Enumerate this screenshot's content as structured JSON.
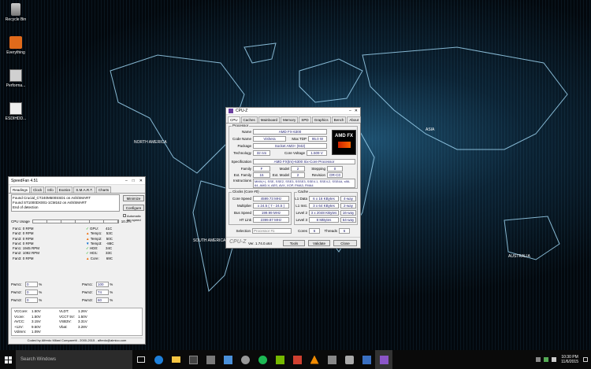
{
  "desktop": {
    "icons": [
      "Recycle Bin",
      "Everything",
      "Performa...",
      "ESDIHDD..."
    ]
  },
  "speedfan": {
    "title": "SpeedFan 4.51",
    "tabs": [
      "Readings",
      "Clock",
      "Info",
      "Exotics",
      "S.M.A.R.T.",
      "Charts"
    ],
    "log": [
      "Found Crucial_CT240M500SSD1 on Ash/SMART",
      "Found ST1000DX001-1CM162 on Ash/SMART",
      "End of detection"
    ],
    "minimize": "Minimize",
    "configure": "Configure",
    "autofan": "Automatic fan speed",
    "cpu_usage_label": "CPU Usage",
    "cpu_usage_value": "10.3%",
    "fans": [
      "Fan1: 0 RPM",
      "Fan2: 0 RPM",
      "Fan3: 0 RPM",
      "Fan4: 0 RPM",
      "Fan1: 1945 RPM",
      "Fan2: 1092 RPM",
      "Fan3: 0 RPM"
    ],
    "temps": [
      {
        "label": "GPU:",
        "value": "41C"
      },
      {
        "label": "Temp1:",
        "value": "53C"
      },
      {
        "label": "Temp2:",
        "value": "50C"
      },
      {
        "label": "Temp3:",
        "value": "-88C"
      },
      {
        "label": "HD0:",
        "value": "34C"
      },
      {
        "label": "HD1:",
        "value": "33C"
      },
      {
        "label": "Core:",
        "value": "69C"
      }
    ],
    "pwm_left": [
      {
        "label": "Pwm1:",
        "value": "0",
        "unit": "%"
      },
      {
        "label": "Pwm2:",
        "value": "0",
        "unit": "%"
      },
      {
        "label": "Pwm3:",
        "value": "0",
        "unit": "%"
      }
    ],
    "pwm_right": [
      {
        "label": "Pwm1:",
        "value": "100",
        "unit": "%"
      },
      {
        "label": "Pwm2:",
        "value": "74",
        "unit": "%"
      },
      {
        "label": "Pwm3:",
        "value": "60",
        "unit": "%"
      }
    ],
    "volts_left": [
      {
        "label": "VCCore:",
        "value": "1.50V"
      },
      {
        "label": "Vcore:",
        "value": "1.50V"
      },
      {
        "label": "AVCC:",
        "value": "3.15V"
      },
      {
        "label": "+12V:",
        "value": "9.50V"
      },
      {
        "label": "Vdimm:",
        "value": "1.09V"
      }
    ],
    "volts_right": [
      {
        "label": "VLDT:",
        "value": "1.26V"
      },
      {
        "label": "VCCT 5V:",
        "value": "1.50V"
      },
      {
        "label": "VSB3V:",
        "value": "3.31V"
      },
      {
        "label": "Vbat:",
        "value": "3.28V"
      }
    ],
    "footer": "Coded by Alfredo Milani Comparetti - 2000-2015 - alfredo@almico.com"
  },
  "cpuz": {
    "title": "CPU-Z",
    "tabs": [
      "CPU",
      "Caches",
      "Mainboard",
      "Memory",
      "SPD",
      "Graphics",
      "Bench",
      "About"
    ],
    "processor_group": "Processor",
    "name_label": "Name",
    "name": "AMD FX-6300",
    "codename_label": "Code Name",
    "codename": "Vishera",
    "tdp_label": "Max TDP",
    "tdp": "95.0 W",
    "package_label": "Package",
    "package": "Socket AM3+ (942)",
    "tech_label": "Technology",
    "tech": "32 nm",
    "cv_label": "Core Voltage",
    "cv": "1.509 V",
    "spec_label": "Specification",
    "spec": "AMD FX(tm)-6300 Six-Core Processor",
    "family_label": "Family",
    "family": "F",
    "model_label": "Model",
    "model": "2",
    "stepping_label": "Stepping",
    "stepping": "0",
    "extfam_label": "Ext. Family",
    "extfam": "15",
    "extmodel_label": "Ext. Model",
    "extmodel": "2",
    "rev_label": "Revision",
    "rev": "OR-C0",
    "instr_label": "Instructions",
    "instr": "MMX(+), SSE, SSE2, SSE3, SSSE3, SSE4.1, SSE4.2, SSE4A, x86-64, AMD-V, AES, AVX, XOP, FMA3, FMA4",
    "clocks_group": "Clocks (Core #0)",
    "caches_group": "Cache",
    "corespeed_label": "Core Speed",
    "corespeed": "4599.73 MHz",
    "mult_label": "Multiplier",
    "mult": "x 24.5 ( 7 - 24.5 )",
    "bus_label": "Bus Speed",
    "bus": "199.99 MHz",
    "ht_label": "HT Link",
    "ht": "2399.87 MHz",
    "l1d_label": "L1 Data",
    "l1d": "6 x 16 KBytes",
    "l1d_way": "4-way",
    "l1i_label": "L1 Inst.",
    "l1i": "3 x 64 KBytes",
    "l1i_way": "2-way",
    "l2_label": "Level 2",
    "l2": "3 x 2048 KBytes",
    "l2_way": "16-way",
    "l3_label": "Level 3",
    "l3": "8 MBytes",
    "l3_way": "64-way",
    "selection_label": "Selection",
    "selection": "Processor #1",
    "cores_label": "Cores",
    "cores": "6",
    "threads_label": "Threads",
    "threads": "6",
    "brand": "CPU-Z",
    "version": "Ver. 1.74.0.x64",
    "tools": "Tools",
    "validate": "Validate",
    "close": "Close",
    "logo_text": "AMD FX"
  },
  "taskbar": {
    "search": "Search Windows",
    "time": "10:30 PM",
    "date": "11/6/2015"
  }
}
